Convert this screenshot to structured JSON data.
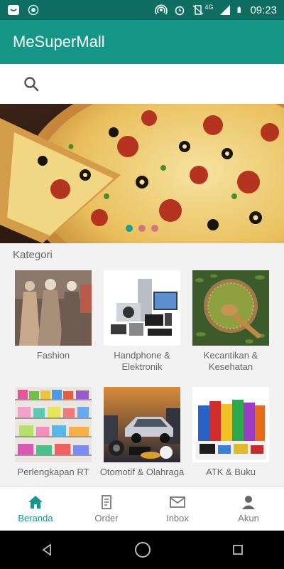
{
  "status_bar": {
    "time": "09:23",
    "network": "4G"
  },
  "app_bar": {
    "title": "MeSuperMall"
  },
  "colors": {
    "primary": "#159687",
    "primary_dark": "#0e6e62",
    "text_muted": "#666666"
  },
  "banner": {
    "pages": 3,
    "active_index": 0
  },
  "categories_section": {
    "title": "Kategori",
    "items": [
      {
        "label": "Fashion"
      },
      {
        "label": "Handphone & Elektronik"
      },
      {
        "label": "Kecantikan & Kesehatan"
      },
      {
        "label": "Perlengkapan RT"
      },
      {
        "label": "Otomotif & Olahraga"
      },
      {
        "label": "ATK & Buku"
      }
    ]
  },
  "bottom_nav": {
    "items": [
      {
        "label": "Beranda",
        "icon": "home-icon",
        "active": true
      },
      {
        "label": "Order",
        "icon": "receipt-icon",
        "active": false
      },
      {
        "label": "Inbox",
        "icon": "mail-icon",
        "active": false
      },
      {
        "label": "Akun",
        "icon": "person-icon",
        "active": false
      }
    ]
  }
}
